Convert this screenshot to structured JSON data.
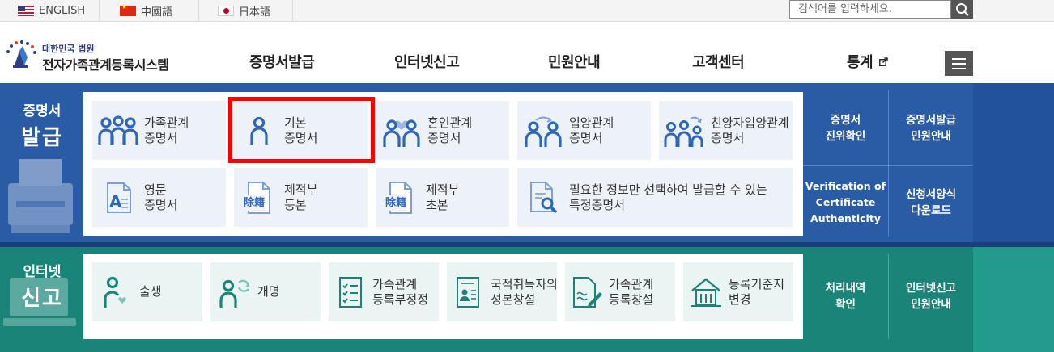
{
  "lang_bar": {
    "english": "ENGLISH",
    "chinese": "中國語",
    "japanese": "日本語"
  },
  "search": {
    "placeholder": "검색어를 입력하세요."
  },
  "logo": {
    "small": "대한민국 법원",
    "big": "전자가족관계등록시스템"
  },
  "nav": {
    "items": [
      "증명서발급",
      "인터넷신고",
      "민원안내",
      "고객센터",
      "통계"
    ]
  },
  "certificates": {
    "title_line1": "증명서",
    "title_line2": "발급",
    "cards": [
      {
        "line1": "가족관계",
        "line2": "증명서",
        "icon": "family-icon"
      },
      {
        "line1": "기본",
        "line2": "증명서",
        "icon": "person-icon"
      },
      {
        "line1": "혼인관계",
        "line2": "증명서",
        "icon": "couple-heart-icon"
      },
      {
        "line1": "입양관계",
        "line2": "증명서",
        "icon": "adoption-icon"
      },
      {
        "line1": "친양자입양관계",
        "line2": "증명서",
        "icon": "adoption-family-icon"
      },
      {
        "line1": "영문",
        "line2": "증명서",
        "icon": "document-a-icon"
      },
      {
        "line1": "제적부",
        "line2": "등본",
        "icon": "document-seal-icon",
        "seal": "除籍"
      },
      {
        "line1": "제적부",
        "line2": "초본",
        "icon": "document-seal-icon",
        "seal": "除籍"
      },
      {
        "line1": "필요한 정보만 선택하여 발급할 수 있는",
        "line2": "특정증명서",
        "icon": "document-search-icon"
      }
    ],
    "side": [
      {
        "line1": "증명서",
        "line2": "진위확인"
      },
      {
        "line1": "증명서발급",
        "line2": "민원안내"
      },
      {
        "line1": "Verification of",
        "line2": "Certificate",
        "line3": "Authenticity"
      },
      {
        "line1": "신청서양식",
        "line2": "다운로드"
      }
    ]
  },
  "report": {
    "title_line1": "인터넷",
    "title_line2": "신고",
    "cards": [
      {
        "line1": "출생",
        "icon": "birth-icon"
      },
      {
        "line1": "개명",
        "icon": "rename-icon"
      },
      {
        "line1": "가족관계",
        "line2": "등록부정정",
        "icon": "checklist-icon"
      },
      {
        "line1": "국적취득자의",
        "line2": "성본창설",
        "icon": "id-card-icon"
      },
      {
        "line1": "가족관계",
        "line2": "등록창설",
        "icon": "document-pen-icon"
      },
      {
        "line1": "등록기준지",
        "line2": "변경",
        "icon": "house-icon"
      }
    ],
    "side": [
      {
        "line1": "처리내역",
        "line2": "확인"
      },
      {
        "line1": "인터넷신고",
        "line2": "민원안내"
      }
    ]
  },
  "colors": {
    "blue_section": "#2a5ba5",
    "green_section": "#1a8478",
    "highlight": "#ff0000",
    "icon_blue": "#2e66b8",
    "icon_teal": "#1a8478"
  }
}
